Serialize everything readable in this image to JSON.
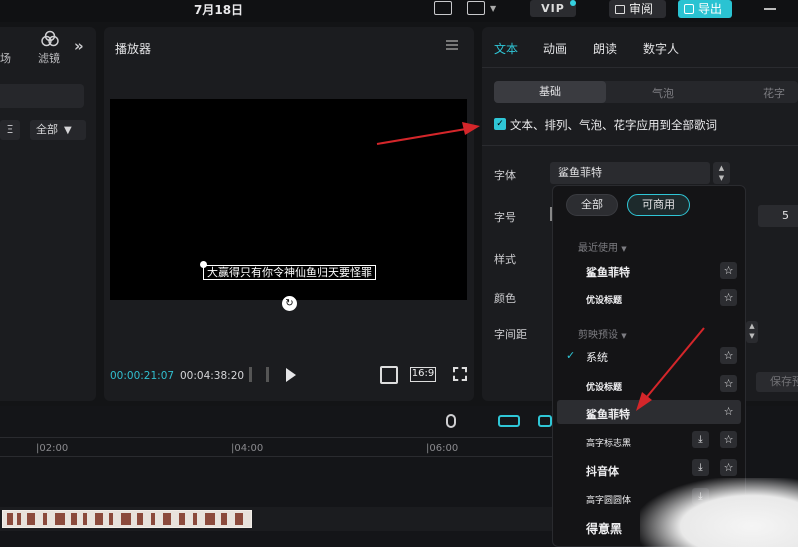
{
  "topbar": {
    "date": "7月18日",
    "vip_label": "VIP",
    "share_label": "审阅",
    "export_label": "导出"
  },
  "left_panel": {
    "partial_tab": "场",
    "filter_tab": "滤镜",
    "sort_label": "Ξ",
    "all_label": "全部"
  },
  "player": {
    "title": "播放器",
    "subtitle_text": "大赢得只有你令神仙鱼归天要怪罪",
    "time_current": "00:00:21:07",
    "time_total": "00:04:38:20",
    "ratio": "16:9"
  },
  "text_panel": {
    "tabs": [
      {
        "label": "文本",
        "active": true
      },
      {
        "label": "动画",
        "active": false
      },
      {
        "label": "朗读",
        "active": false
      },
      {
        "label": "数字人",
        "active": false
      }
    ],
    "subtabs": [
      "基础",
      "气泡",
      "花字"
    ],
    "apply_all_label": "文本、排列、气泡、花字应用到全部歌词",
    "labels": {
      "font": "字体",
      "size": "字号",
      "style": "样式",
      "color": "颜色",
      "spacing": "字间距"
    },
    "font_value": "鲨鱼菲特",
    "size_value": "5",
    "save_preset": "保存预"
  },
  "font_dropdown": {
    "pills": [
      "全部",
      "可商用"
    ],
    "sections": [
      "最近使用",
      "剪映预设"
    ],
    "recent": [
      "鲨鱼菲特",
      "优设标题"
    ],
    "preset": [
      {
        "name": "系统",
        "checked": true,
        "download": false
      },
      {
        "name": "优设标题",
        "checked": false,
        "download": false
      },
      {
        "name": "鲨鱼菲特",
        "checked": false,
        "download": false
      },
      {
        "name": "高字标志黑",
        "checked": false,
        "download": true
      },
      {
        "name": "抖音体",
        "checked": false,
        "download": true
      },
      {
        "name": "高字圆圆体",
        "checked": false,
        "download": true
      },
      {
        "name": "得意黑",
        "checked": false,
        "download": false
      }
    ],
    "check_glyph": "✓",
    "star_glyph": "☆",
    "download_glyph": "⤓"
  },
  "timeline": {
    "ticks": [
      "|02:00",
      "|04:00",
      "|06:00"
    ]
  },
  "colors": {
    "accent": "#2fc6d6",
    "arrow": "#d4262a",
    "panel": "#1b1c1f"
  }
}
